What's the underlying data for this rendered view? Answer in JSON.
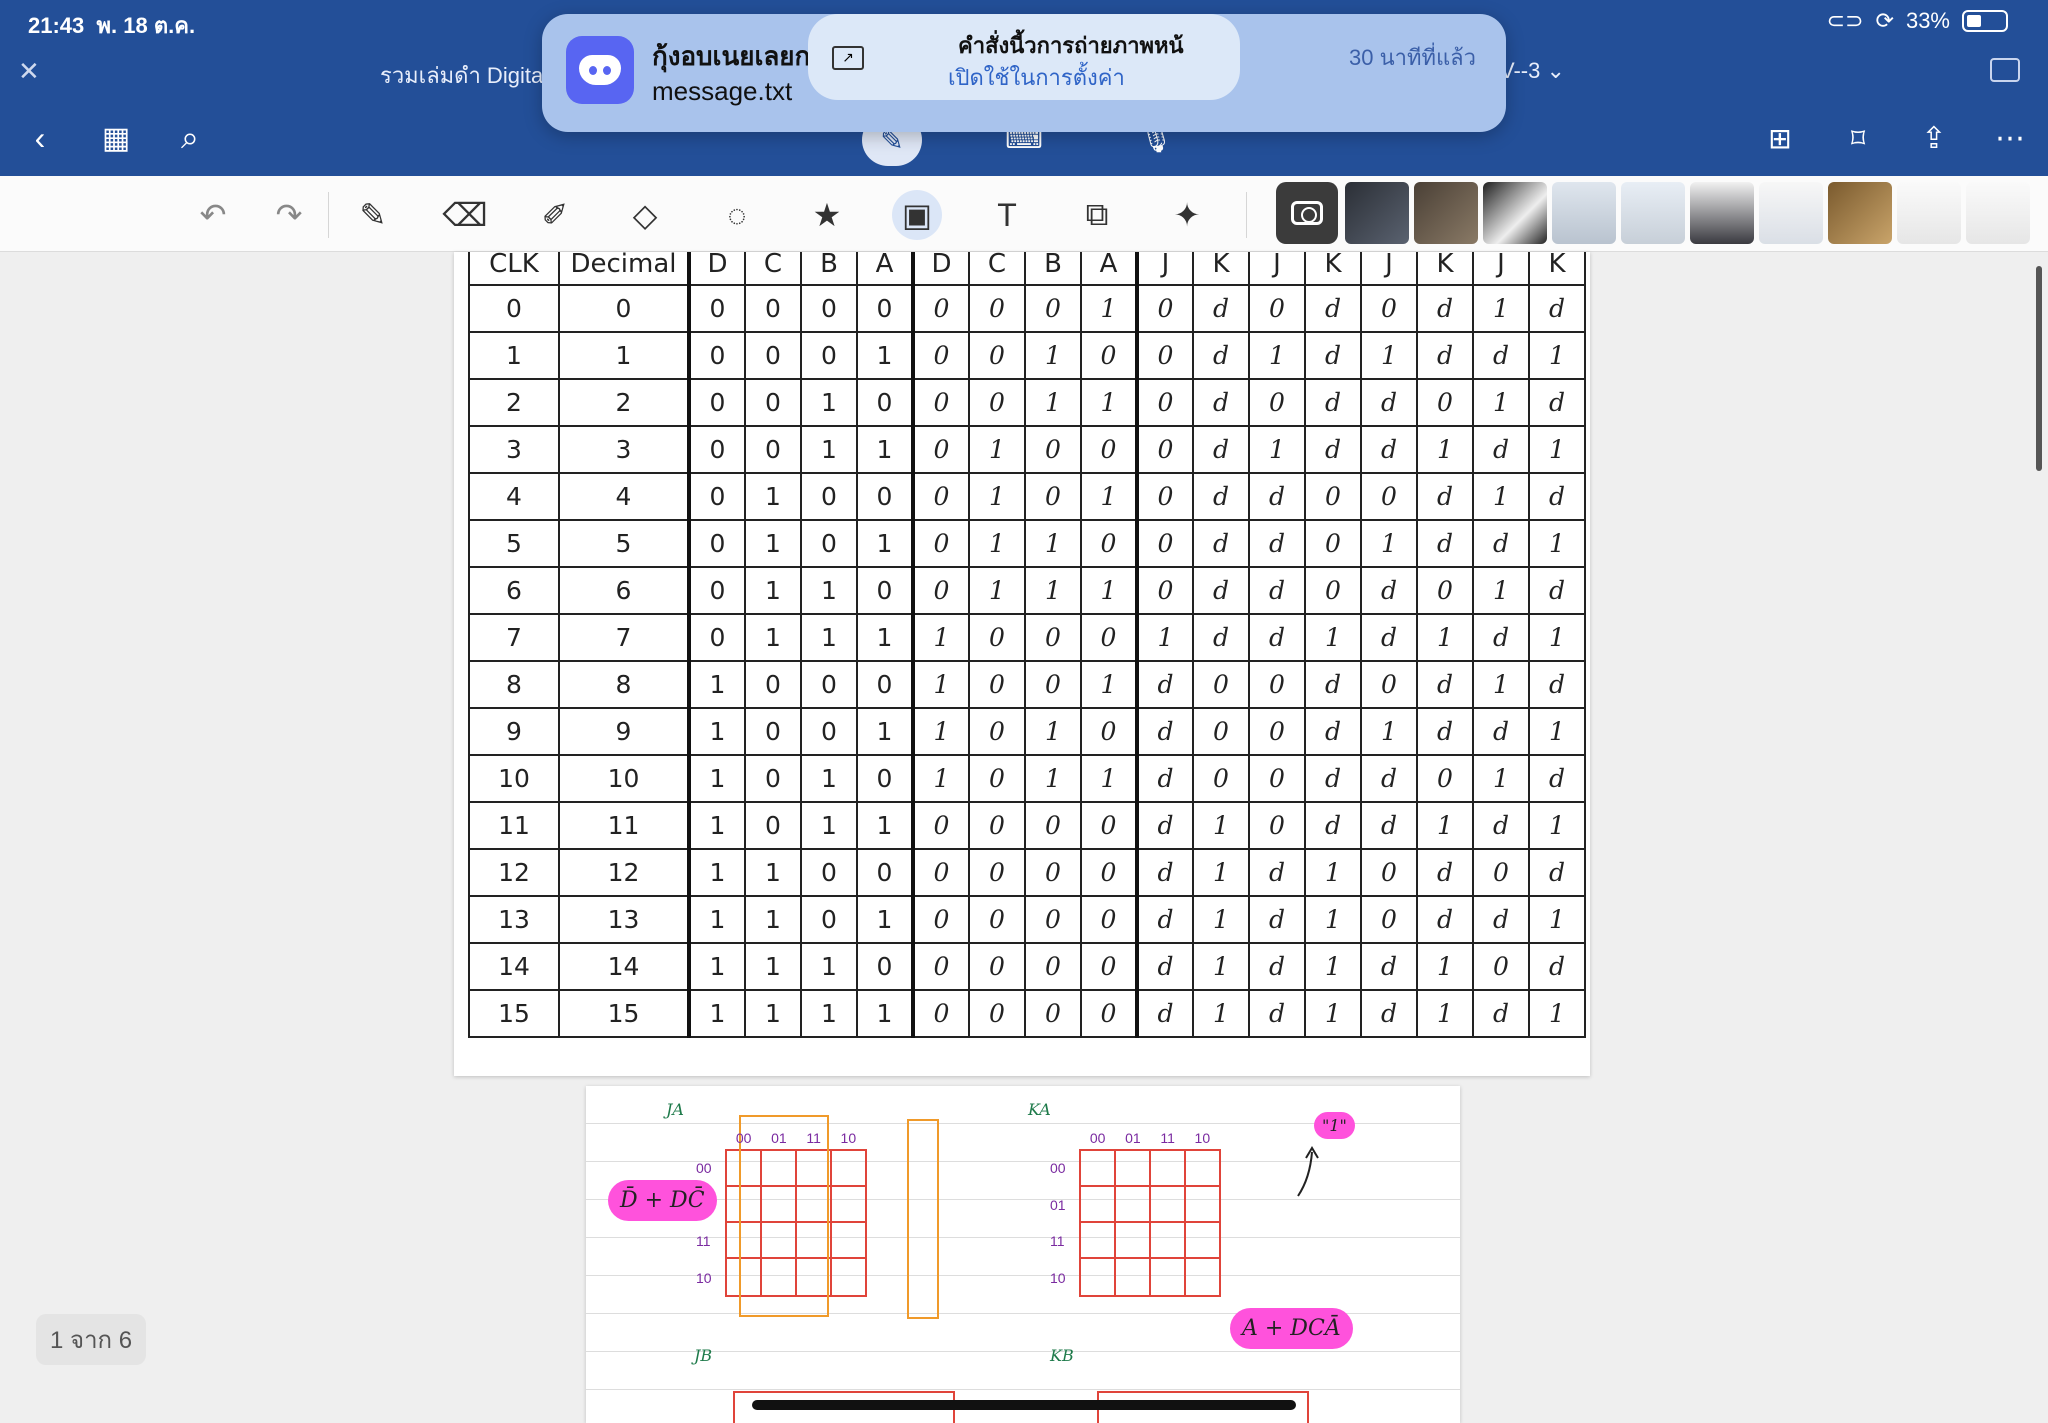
{
  "status": {
    "time": "21:43",
    "date": "พ. 18 ต.ค.",
    "battery": "33%"
  },
  "header": {
    "doc_title": "รวมเล่มดำ Digita",
    "doc_title_right": "V--3"
  },
  "notification": {
    "app_title": "กุ้งอบเนยเลยก",
    "subtitle": "message.txt",
    "time": "30 นาทีที่แล้ว",
    "popup_line1": "คำสั่งนี้วการถ่ายภาพหน้",
    "popup_line2": "เปิดใช้ในการตั้งค่า"
  },
  "icons": {
    "back": "chevron-left-icon",
    "grid": "grid-icon",
    "search": "search-icon",
    "add_page": "add-page-icon",
    "bookmark": "bookmark-icon",
    "share": "share-icon",
    "more": "more-icon"
  },
  "truth_table": {
    "headers": [
      "CLK",
      "Decimal",
      "D",
      "C",
      "B",
      "A",
      "D",
      "C",
      "B",
      "A",
      "J",
      "K",
      "J",
      "K",
      "J",
      "K",
      "J",
      "K"
    ],
    "rows": [
      [
        "0",
        "0",
        "0",
        "0",
        "0",
        "0",
        "0",
        "0",
        "0",
        "1",
        "0",
        "d",
        "0",
        "d",
        "0",
        "d",
        "1",
        "d"
      ],
      [
        "1",
        "1",
        "0",
        "0",
        "0",
        "1",
        "0",
        "0",
        "1",
        "0",
        "0",
        "d",
        "1",
        "d",
        "1",
        "d",
        "d",
        "1"
      ],
      [
        "2",
        "2",
        "0",
        "0",
        "1",
        "0",
        "0",
        "0",
        "1",
        "1",
        "0",
        "d",
        "0",
        "d",
        "d",
        "0",
        "1",
        "d"
      ],
      [
        "3",
        "3",
        "0",
        "0",
        "1",
        "1",
        "0",
        "1",
        "0",
        "0",
        "0",
        "d",
        "1",
        "d",
        "d",
        "1",
        "d",
        "1"
      ],
      [
        "4",
        "4",
        "0",
        "1",
        "0",
        "0",
        "0",
        "1",
        "0",
        "1",
        "0",
        "d",
        "d",
        "0",
        "0",
        "d",
        "1",
        "d"
      ],
      [
        "5",
        "5",
        "0",
        "1",
        "0",
        "1",
        "0",
        "1",
        "1",
        "0",
        "0",
        "d",
        "d",
        "0",
        "1",
        "d",
        "d",
        "1"
      ],
      [
        "6",
        "6",
        "0",
        "1",
        "1",
        "0",
        "0",
        "1",
        "1",
        "1",
        "0",
        "d",
        "d",
        "0",
        "d",
        "0",
        "1",
        "d"
      ],
      [
        "7",
        "7",
        "0",
        "1",
        "1",
        "1",
        "1",
        "0",
        "0",
        "0",
        "1",
        "d",
        "d",
        "1",
        "d",
        "1",
        "d",
        "1"
      ],
      [
        "8",
        "8",
        "1",
        "0",
        "0",
        "0",
        "1",
        "0",
        "0",
        "1",
        "d",
        "0",
        "0",
        "d",
        "0",
        "d",
        "1",
        "d"
      ],
      [
        "9",
        "9",
        "1",
        "0",
        "0",
        "1",
        "1",
        "0",
        "1",
        "0",
        "d",
        "0",
        "0",
        "d",
        "1",
        "d",
        "d",
        "1"
      ],
      [
        "10",
        "10",
        "1",
        "0",
        "1",
        "0",
        "1",
        "0",
        "1",
        "1",
        "d",
        "0",
        "0",
        "d",
        "d",
        "0",
        "1",
        "d"
      ],
      [
        "11",
        "11",
        "1",
        "0",
        "1",
        "1",
        "0",
        "0",
        "0",
        "0",
        "d",
        "1",
        "0",
        "d",
        "d",
        "1",
        "d",
        "1"
      ],
      [
        "12",
        "12",
        "1",
        "1",
        "0",
        "0",
        "0",
        "0",
        "0",
        "0",
        "d",
        "1",
        "d",
        "1",
        "0",
        "d",
        "0",
        "d"
      ],
      [
        "13",
        "13",
        "1",
        "1",
        "0",
        "1",
        "0",
        "0",
        "0",
        "0",
        "d",
        "1",
        "d",
        "1",
        "0",
        "d",
        "d",
        "1"
      ],
      [
        "14",
        "14",
        "1",
        "1",
        "1",
        "0",
        "0",
        "0",
        "0",
        "0",
        "d",
        "1",
        "d",
        "1",
        "d",
        "1",
        "0",
        "d"
      ],
      [
        "15",
        "15",
        "1",
        "1",
        "1",
        "1",
        "0",
        "0",
        "0",
        "0",
        "d",
        "1",
        "d",
        "1",
        "d",
        "1",
        "d",
        "1"
      ]
    ]
  },
  "kmaps": {
    "ja_label": "JA",
    "ka_label": "KA",
    "jb_label": "JB",
    "kb_label": "KB",
    "col_codes": [
      "00",
      "01",
      "11",
      "10"
    ],
    "row_codes": [
      "00",
      "01",
      "11",
      "10"
    ],
    "ja_expr": "D̄ + DC̄",
    "ka_expr": "\"1\"",
    "jb_expr": "A + DCĀ"
  },
  "page_indicator": "1 จาก 6"
}
